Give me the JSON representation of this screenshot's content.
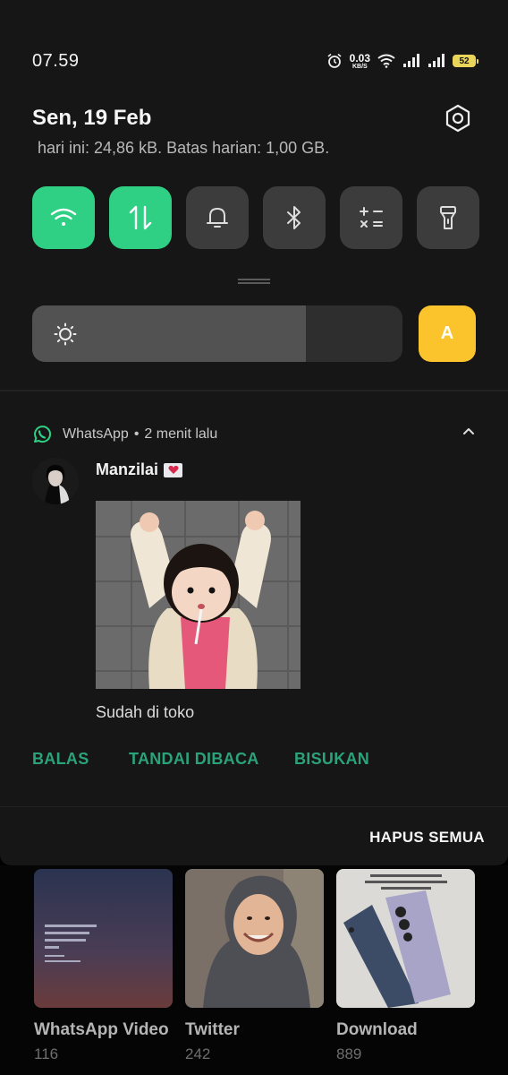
{
  "status_bar": {
    "time": "07.59",
    "net_speed_value": "0.03",
    "net_speed_unit": "KB/S",
    "battery": "52"
  },
  "header": {
    "date": "Sen, 19 Feb",
    "data_usage": "hari ini: 24,86 kB. Batas harian: 1,00 GB."
  },
  "quick_tiles": [
    {
      "name": "wifi",
      "state": "on"
    },
    {
      "name": "mobile-data",
      "state": "on"
    },
    {
      "name": "sound",
      "state": "off"
    },
    {
      "name": "bluetooth",
      "state": "off"
    },
    {
      "name": "calculator",
      "state": "off"
    },
    {
      "name": "flashlight",
      "state": "off"
    }
  ],
  "brightness": {
    "level_percent": 74,
    "auto_label": "A"
  },
  "notification": {
    "app": "WhatsApp",
    "time_ago": "2 menit lalu",
    "sender": "Manzilai",
    "message": "Sudah di toko",
    "actions": {
      "reply": "BALAS",
      "mark_read": "TANDAI DIBACA",
      "mute": "BISUKAN"
    }
  },
  "clear_all": "HAPUS SEMUA",
  "gallery": {
    "albums": [
      {
        "name": "WhatsApp Video",
        "count": "116"
      },
      {
        "name": "Twitter",
        "count": "242"
      },
      {
        "name": "Download",
        "count": "889"
      }
    ]
  },
  "colors": {
    "tile_on": "#2fd083",
    "accent_action": "#2aa37a",
    "auto_brightness": "#fcc42c"
  }
}
